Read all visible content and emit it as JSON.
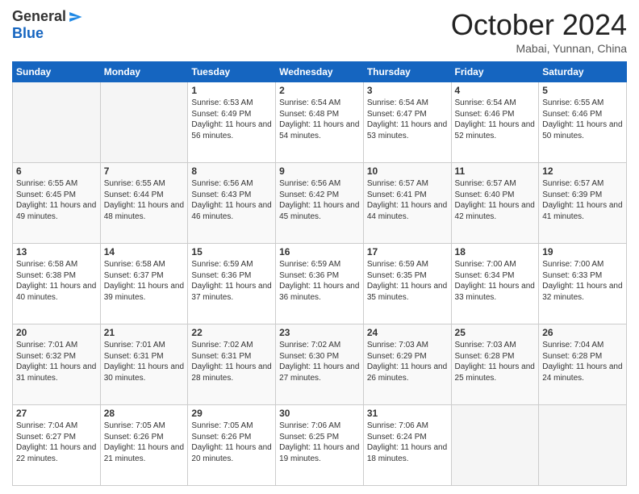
{
  "logo": {
    "general": "General",
    "blue": "Blue"
  },
  "title": "October 2024",
  "location": "Mabai, Yunnan, China",
  "weekdays": [
    "Sunday",
    "Monday",
    "Tuesday",
    "Wednesday",
    "Thursday",
    "Friday",
    "Saturday"
  ],
  "weeks": [
    [
      {
        "day": "",
        "sunrise": "",
        "sunset": "",
        "daylight": ""
      },
      {
        "day": "",
        "sunrise": "",
        "sunset": "",
        "daylight": ""
      },
      {
        "day": "1",
        "sunrise": "Sunrise: 6:53 AM",
        "sunset": "Sunset: 6:49 PM",
        "daylight": "Daylight: 11 hours and 56 minutes."
      },
      {
        "day": "2",
        "sunrise": "Sunrise: 6:54 AM",
        "sunset": "Sunset: 6:48 PM",
        "daylight": "Daylight: 11 hours and 54 minutes."
      },
      {
        "day": "3",
        "sunrise": "Sunrise: 6:54 AM",
        "sunset": "Sunset: 6:47 PM",
        "daylight": "Daylight: 11 hours and 53 minutes."
      },
      {
        "day": "4",
        "sunrise": "Sunrise: 6:54 AM",
        "sunset": "Sunset: 6:46 PM",
        "daylight": "Daylight: 11 hours and 52 minutes."
      },
      {
        "day": "5",
        "sunrise": "Sunrise: 6:55 AM",
        "sunset": "Sunset: 6:46 PM",
        "daylight": "Daylight: 11 hours and 50 minutes."
      }
    ],
    [
      {
        "day": "6",
        "sunrise": "Sunrise: 6:55 AM",
        "sunset": "Sunset: 6:45 PM",
        "daylight": "Daylight: 11 hours and 49 minutes."
      },
      {
        "day": "7",
        "sunrise": "Sunrise: 6:55 AM",
        "sunset": "Sunset: 6:44 PM",
        "daylight": "Daylight: 11 hours and 48 minutes."
      },
      {
        "day": "8",
        "sunrise": "Sunrise: 6:56 AM",
        "sunset": "Sunset: 6:43 PM",
        "daylight": "Daylight: 11 hours and 46 minutes."
      },
      {
        "day": "9",
        "sunrise": "Sunrise: 6:56 AM",
        "sunset": "Sunset: 6:42 PM",
        "daylight": "Daylight: 11 hours and 45 minutes."
      },
      {
        "day": "10",
        "sunrise": "Sunrise: 6:57 AM",
        "sunset": "Sunset: 6:41 PM",
        "daylight": "Daylight: 11 hours and 44 minutes."
      },
      {
        "day": "11",
        "sunrise": "Sunrise: 6:57 AM",
        "sunset": "Sunset: 6:40 PM",
        "daylight": "Daylight: 11 hours and 42 minutes."
      },
      {
        "day": "12",
        "sunrise": "Sunrise: 6:57 AM",
        "sunset": "Sunset: 6:39 PM",
        "daylight": "Daylight: 11 hours and 41 minutes."
      }
    ],
    [
      {
        "day": "13",
        "sunrise": "Sunrise: 6:58 AM",
        "sunset": "Sunset: 6:38 PM",
        "daylight": "Daylight: 11 hours and 40 minutes."
      },
      {
        "day": "14",
        "sunrise": "Sunrise: 6:58 AM",
        "sunset": "Sunset: 6:37 PM",
        "daylight": "Daylight: 11 hours and 39 minutes."
      },
      {
        "day": "15",
        "sunrise": "Sunrise: 6:59 AM",
        "sunset": "Sunset: 6:36 PM",
        "daylight": "Daylight: 11 hours and 37 minutes."
      },
      {
        "day": "16",
        "sunrise": "Sunrise: 6:59 AM",
        "sunset": "Sunset: 6:36 PM",
        "daylight": "Daylight: 11 hours and 36 minutes."
      },
      {
        "day": "17",
        "sunrise": "Sunrise: 6:59 AM",
        "sunset": "Sunset: 6:35 PM",
        "daylight": "Daylight: 11 hours and 35 minutes."
      },
      {
        "day": "18",
        "sunrise": "Sunrise: 7:00 AM",
        "sunset": "Sunset: 6:34 PM",
        "daylight": "Daylight: 11 hours and 33 minutes."
      },
      {
        "day": "19",
        "sunrise": "Sunrise: 7:00 AM",
        "sunset": "Sunset: 6:33 PM",
        "daylight": "Daylight: 11 hours and 32 minutes."
      }
    ],
    [
      {
        "day": "20",
        "sunrise": "Sunrise: 7:01 AM",
        "sunset": "Sunset: 6:32 PM",
        "daylight": "Daylight: 11 hours and 31 minutes."
      },
      {
        "day": "21",
        "sunrise": "Sunrise: 7:01 AM",
        "sunset": "Sunset: 6:31 PM",
        "daylight": "Daylight: 11 hours and 30 minutes."
      },
      {
        "day": "22",
        "sunrise": "Sunrise: 7:02 AM",
        "sunset": "Sunset: 6:31 PM",
        "daylight": "Daylight: 11 hours and 28 minutes."
      },
      {
        "day": "23",
        "sunrise": "Sunrise: 7:02 AM",
        "sunset": "Sunset: 6:30 PM",
        "daylight": "Daylight: 11 hours and 27 minutes."
      },
      {
        "day": "24",
        "sunrise": "Sunrise: 7:03 AM",
        "sunset": "Sunset: 6:29 PM",
        "daylight": "Daylight: 11 hours and 26 minutes."
      },
      {
        "day": "25",
        "sunrise": "Sunrise: 7:03 AM",
        "sunset": "Sunset: 6:28 PM",
        "daylight": "Daylight: 11 hours and 25 minutes."
      },
      {
        "day": "26",
        "sunrise": "Sunrise: 7:04 AM",
        "sunset": "Sunset: 6:28 PM",
        "daylight": "Daylight: 11 hours and 24 minutes."
      }
    ],
    [
      {
        "day": "27",
        "sunrise": "Sunrise: 7:04 AM",
        "sunset": "Sunset: 6:27 PM",
        "daylight": "Daylight: 11 hours and 22 minutes."
      },
      {
        "day": "28",
        "sunrise": "Sunrise: 7:05 AM",
        "sunset": "Sunset: 6:26 PM",
        "daylight": "Daylight: 11 hours and 21 minutes."
      },
      {
        "day": "29",
        "sunrise": "Sunrise: 7:05 AM",
        "sunset": "Sunset: 6:26 PM",
        "daylight": "Daylight: 11 hours and 20 minutes."
      },
      {
        "day": "30",
        "sunrise": "Sunrise: 7:06 AM",
        "sunset": "Sunset: 6:25 PM",
        "daylight": "Daylight: 11 hours and 19 minutes."
      },
      {
        "day": "31",
        "sunrise": "Sunrise: 7:06 AM",
        "sunset": "Sunset: 6:24 PM",
        "daylight": "Daylight: 11 hours and 18 minutes."
      },
      {
        "day": "",
        "sunrise": "",
        "sunset": "",
        "daylight": ""
      },
      {
        "day": "",
        "sunrise": "",
        "sunset": "",
        "daylight": ""
      }
    ]
  ]
}
